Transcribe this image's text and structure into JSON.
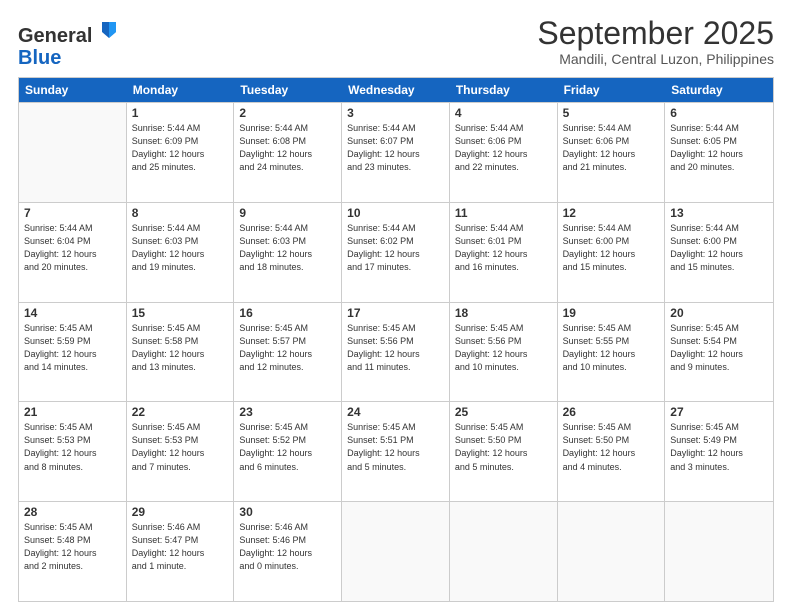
{
  "logo": {
    "general": "General",
    "blue": "Blue"
  },
  "title": "September 2025",
  "subtitle": "Mandili, Central Luzon, Philippines",
  "header_days": [
    "Sunday",
    "Monday",
    "Tuesday",
    "Wednesday",
    "Thursday",
    "Friday",
    "Saturday"
  ],
  "weeks": [
    [
      {
        "day": "",
        "lines": []
      },
      {
        "day": "1",
        "lines": [
          "Sunrise: 5:44 AM",
          "Sunset: 6:09 PM",
          "Daylight: 12 hours",
          "and 25 minutes."
        ]
      },
      {
        "day": "2",
        "lines": [
          "Sunrise: 5:44 AM",
          "Sunset: 6:08 PM",
          "Daylight: 12 hours",
          "and 24 minutes."
        ]
      },
      {
        "day": "3",
        "lines": [
          "Sunrise: 5:44 AM",
          "Sunset: 6:07 PM",
          "Daylight: 12 hours",
          "and 23 minutes."
        ]
      },
      {
        "day": "4",
        "lines": [
          "Sunrise: 5:44 AM",
          "Sunset: 6:06 PM",
          "Daylight: 12 hours",
          "and 22 minutes."
        ]
      },
      {
        "day": "5",
        "lines": [
          "Sunrise: 5:44 AM",
          "Sunset: 6:06 PM",
          "Daylight: 12 hours",
          "and 21 minutes."
        ]
      },
      {
        "day": "6",
        "lines": [
          "Sunrise: 5:44 AM",
          "Sunset: 6:05 PM",
          "Daylight: 12 hours",
          "and 20 minutes."
        ]
      }
    ],
    [
      {
        "day": "7",
        "lines": [
          "Sunrise: 5:44 AM",
          "Sunset: 6:04 PM",
          "Daylight: 12 hours",
          "and 20 minutes."
        ]
      },
      {
        "day": "8",
        "lines": [
          "Sunrise: 5:44 AM",
          "Sunset: 6:03 PM",
          "Daylight: 12 hours",
          "and 19 minutes."
        ]
      },
      {
        "day": "9",
        "lines": [
          "Sunrise: 5:44 AM",
          "Sunset: 6:03 PM",
          "Daylight: 12 hours",
          "and 18 minutes."
        ]
      },
      {
        "day": "10",
        "lines": [
          "Sunrise: 5:44 AM",
          "Sunset: 6:02 PM",
          "Daylight: 12 hours",
          "and 17 minutes."
        ]
      },
      {
        "day": "11",
        "lines": [
          "Sunrise: 5:44 AM",
          "Sunset: 6:01 PM",
          "Daylight: 12 hours",
          "and 16 minutes."
        ]
      },
      {
        "day": "12",
        "lines": [
          "Sunrise: 5:44 AM",
          "Sunset: 6:00 PM",
          "Daylight: 12 hours",
          "and 15 minutes."
        ]
      },
      {
        "day": "13",
        "lines": [
          "Sunrise: 5:44 AM",
          "Sunset: 6:00 PM",
          "Daylight: 12 hours",
          "and 15 minutes."
        ]
      }
    ],
    [
      {
        "day": "14",
        "lines": [
          "Sunrise: 5:45 AM",
          "Sunset: 5:59 PM",
          "Daylight: 12 hours",
          "and 14 minutes."
        ]
      },
      {
        "day": "15",
        "lines": [
          "Sunrise: 5:45 AM",
          "Sunset: 5:58 PM",
          "Daylight: 12 hours",
          "and 13 minutes."
        ]
      },
      {
        "day": "16",
        "lines": [
          "Sunrise: 5:45 AM",
          "Sunset: 5:57 PM",
          "Daylight: 12 hours",
          "and 12 minutes."
        ]
      },
      {
        "day": "17",
        "lines": [
          "Sunrise: 5:45 AM",
          "Sunset: 5:56 PM",
          "Daylight: 12 hours",
          "and 11 minutes."
        ]
      },
      {
        "day": "18",
        "lines": [
          "Sunrise: 5:45 AM",
          "Sunset: 5:56 PM",
          "Daylight: 12 hours",
          "and 10 minutes."
        ]
      },
      {
        "day": "19",
        "lines": [
          "Sunrise: 5:45 AM",
          "Sunset: 5:55 PM",
          "Daylight: 12 hours",
          "and 10 minutes."
        ]
      },
      {
        "day": "20",
        "lines": [
          "Sunrise: 5:45 AM",
          "Sunset: 5:54 PM",
          "Daylight: 12 hours",
          "and 9 minutes."
        ]
      }
    ],
    [
      {
        "day": "21",
        "lines": [
          "Sunrise: 5:45 AM",
          "Sunset: 5:53 PM",
          "Daylight: 12 hours",
          "and 8 minutes."
        ]
      },
      {
        "day": "22",
        "lines": [
          "Sunrise: 5:45 AM",
          "Sunset: 5:53 PM",
          "Daylight: 12 hours",
          "and 7 minutes."
        ]
      },
      {
        "day": "23",
        "lines": [
          "Sunrise: 5:45 AM",
          "Sunset: 5:52 PM",
          "Daylight: 12 hours",
          "and 6 minutes."
        ]
      },
      {
        "day": "24",
        "lines": [
          "Sunrise: 5:45 AM",
          "Sunset: 5:51 PM",
          "Daylight: 12 hours",
          "and 5 minutes."
        ]
      },
      {
        "day": "25",
        "lines": [
          "Sunrise: 5:45 AM",
          "Sunset: 5:50 PM",
          "Daylight: 12 hours",
          "and 5 minutes."
        ]
      },
      {
        "day": "26",
        "lines": [
          "Sunrise: 5:45 AM",
          "Sunset: 5:50 PM",
          "Daylight: 12 hours",
          "and 4 minutes."
        ]
      },
      {
        "day": "27",
        "lines": [
          "Sunrise: 5:45 AM",
          "Sunset: 5:49 PM",
          "Daylight: 12 hours",
          "and 3 minutes."
        ]
      }
    ],
    [
      {
        "day": "28",
        "lines": [
          "Sunrise: 5:45 AM",
          "Sunset: 5:48 PM",
          "Daylight: 12 hours",
          "and 2 minutes."
        ]
      },
      {
        "day": "29",
        "lines": [
          "Sunrise: 5:46 AM",
          "Sunset: 5:47 PM",
          "Daylight: 12 hours",
          "and 1 minute."
        ]
      },
      {
        "day": "30",
        "lines": [
          "Sunrise: 5:46 AM",
          "Sunset: 5:46 PM",
          "Daylight: 12 hours",
          "and 0 minutes."
        ]
      },
      {
        "day": "",
        "lines": []
      },
      {
        "day": "",
        "lines": []
      },
      {
        "day": "",
        "lines": []
      },
      {
        "day": "",
        "lines": []
      }
    ]
  ]
}
